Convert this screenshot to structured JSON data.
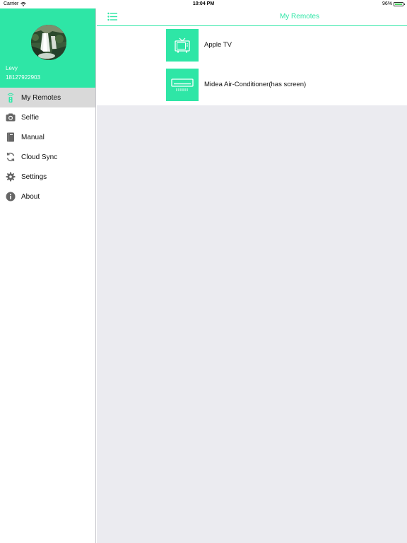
{
  "status_bar": {
    "carrier": "Carrier",
    "time": "10:04 PM",
    "battery": "96%",
    "battery_level": 0.96
  },
  "profile": {
    "name": "Levy",
    "phone": "18127922903"
  },
  "sidebar": {
    "items": [
      {
        "label": "My Remotes",
        "icon": "remote-icon",
        "active": true
      },
      {
        "label": "Selfie",
        "icon": "camera-icon",
        "active": false
      },
      {
        "label": "Manual",
        "icon": "book-icon",
        "active": false
      },
      {
        "label": "Cloud Sync",
        "icon": "sync-icon",
        "active": false
      },
      {
        "label": "Settings",
        "icon": "gear-icon",
        "active": false
      },
      {
        "label": "About",
        "icon": "info-icon",
        "active": false
      }
    ]
  },
  "header": {
    "title": "My Remotes",
    "menu_icon": "list-menu-icon"
  },
  "remotes": [
    {
      "name": "Apple TV",
      "icon": "tv-icon"
    },
    {
      "name": "Midea Air-Conditioner(has screen)",
      "icon": "air-conditioner-icon"
    }
  ],
  "colors": {
    "accent": "#2ee6a6",
    "active_item": "#d9d9d9",
    "content_bg": "#ebebf0"
  }
}
